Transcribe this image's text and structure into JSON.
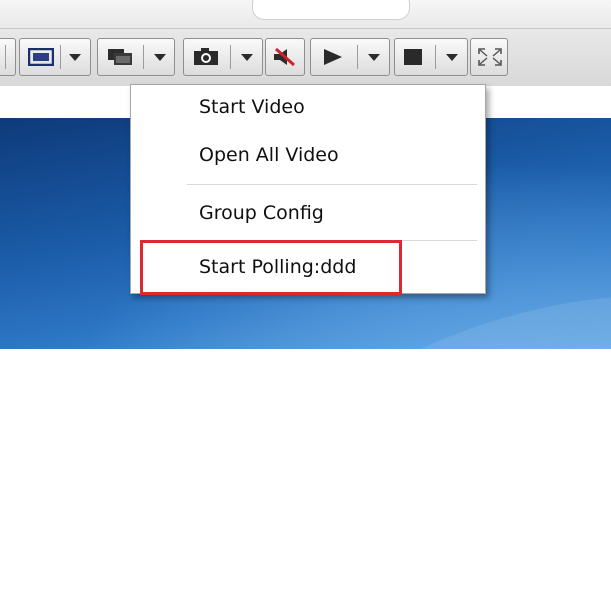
{
  "context_menu": {
    "items": [
      {
        "label": "Start Video"
      },
      {
        "label": "Open All Video"
      },
      {
        "label": "Group Config"
      },
      {
        "label": "Start Polling:ddd"
      }
    ]
  },
  "toolbar": {
    "buttons": [
      {
        "icon": "window-frame-icon"
      },
      {
        "icon": "split-window-icon"
      },
      {
        "icon": "camera-icon"
      },
      {
        "icon": "speaker-mute-icon"
      },
      {
        "icon": "play-icon"
      },
      {
        "icon": "stop-icon"
      },
      {
        "icon": "fullscreen-icon"
      }
    ]
  },
  "annotation": {
    "highlight_color": "#e0262e"
  }
}
